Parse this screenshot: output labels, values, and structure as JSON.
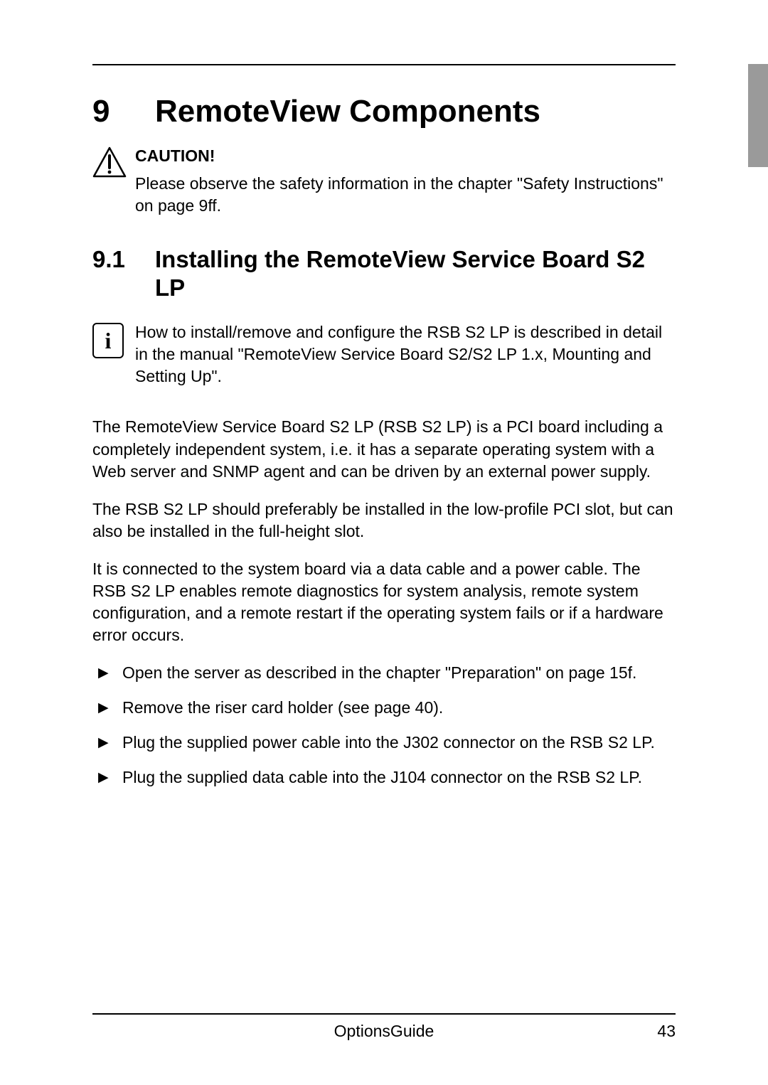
{
  "chapter": {
    "number": "9",
    "title": "RemoteView Components"
  },
  "caution": {
    "label": "CAUTION!",
    "text": "Please observe the safety information in the chapter \"Safety Instructions\" on page 9ff."
  },
  "section": {
    "number": "9.1",
    "title": "Installing the RemoteView Service Board S2 LP"
  },
  "info": {
    "text": "How to install/remove and configure the RSB S2 LP is described in detail in the manual \"RemoteView Service Board S2/S2 LP 1.x, Mounting and Setting Up\"."
  },
  "paragraphs": [
    "The RemoteView Service Board S2 LP (RSB S2 LP) is a PCI board including a completely independent system, i.e. it has a separate operating system with a Web server and SNMP agent and can be driven by an external power supply.",
    "The RSB S2 LP should preferably be installed in the low-profile PCI slot, but can also be installed in the full-height slot.",
    "It is connected to the system board via a data cable and a power cable. The RSB S2 LP enables remote diagnostics for system analysis, remote system configuration, and a remote restart if the operating system fails or if a hardware error occurs."
  ],
  "steps": [
    "Open the server as described in the chapter \"Preparation\" on page 15f.",
    "Remove the riser card holder (see page 40).",
    "Plug the supplied power cable into the J302 connector on the RSB S2 LP.",
    "Plug the supplied data cable into the J104 connector on the RSB S2 LP."
  ],
  "footer": {
    "title": "OptionsGuide",
    "page": "43"
  }
}
